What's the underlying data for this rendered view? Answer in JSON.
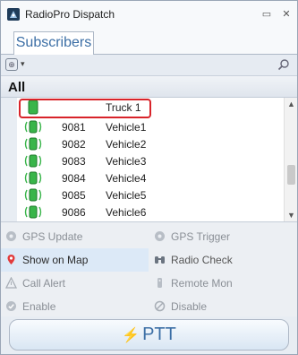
{
  "window": {
    "title": "RadioPro Dispatch",
    "minimize_glyph": "▭",
    "close_glyph": "✕"
  },
  "tabs": [
    {
      "label": "Subscribers",
      "selected": true
    }
  ],
  "toolbar": {
    "view_icon": "view-icon",
    "caret": "▾",
    "search_icon": "search-icon"
  },
  "group": {
    "label": "All"
  },
  "subscribers": [
    {
      "id": "",
      "name": "Truck 1",
      "icon": "green-radio-icon",
      "selected": true
    },
    {
      "id": "9081",
      "name": "Vehicle1",
      "icon": "radio-signal-icon"
    },
    {
      "id": "9082",
      "name": "Vehicle2",
      "icon": "radio-signal-icon"
    },
    {
      "id": "9083",
      "name": "Vehicle3",
      "icon": "radio-signal-icon"
    },
    {
      "id": "9084",
      "name": "Vehicle4",
      "icon": "radio-signal-icon"
    },
    {
      "id": "9085",
      "name": "Vehicle5",
      "icon": "radio-signal-icon"
    },
    {
      "id": "9086",
      "name": "Vehicle6",
      "icon": "radio-signal-icon"
    }
  ],
  "actions": {
    "gps_update": "GPS Update",
    "gps_trigger": "GPS Trigger",
    "show_on_map": "Show on Map",
    "radio_check": "Radio Check",
    "call_alert": "Call Alert",
    "remote_mon": "Remote Mon",
    "enable": "Enable",
    "disable": "Disable"
  },
  "ptt": {
    "label": "PTT"
  },
  "colors": {
    "accent": "#3b6ea5",
    "selection_border": "#d8232a",
    "active_action": "#dce9f7",
    "radio_green": "#39b54a"
  }
}
